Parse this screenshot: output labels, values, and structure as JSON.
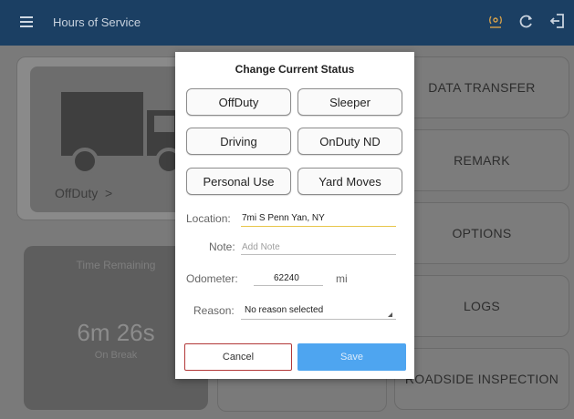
{
  "appbar": {
    "title": "Hours of Service",
    "icons": [
      "menu-icon",
      "eld-connection-icon",
      "refresh-icon",
      "logout-icon"
    ]
  },
  "background": {
    "current_status": "OffDuty",
    "status_chevron": ">",
    "time_remaining_label": "Time Remaining",
    "time_value": "6m 26s",
    "time_sub": "On Break",
    "side_buttons": [
      "DATA TRANSFER",
      "REMARK",
      "OPTIONS",
      "LOGS",
      "ROADSIDE INSPECTION"
    ]
  },
  "dialog": {
    "title": "Change Current Status",
    "status_options": [
      "OffDuty",
      "Sleeper",
      "Driving",
      "OnDuty ND",
      "Personal Use",
      "Yard Moves"
    ],
    "location_label": "Location:",
    "location_value": "7mi S Penn Yan, NY",
    "note_label": "Note:",
    "note_placeholder": "Add Note",
    "odometer_label": "Odometer:",
    "odometer_value": "62240",
    "odometer_unit": "mi",
    "reason_label": "Reason:",
    "reason_value": "No reason selected",
    "cancel_label": "Cancel",
    "save_label": "Save"
  },
  "colors": {
    "appbar": "#1b3f63",
    "save_button": "#4ea5f0",
    "cancel_border": "#b23838",
    "location_underline": "#e8c64a"
  }
}
